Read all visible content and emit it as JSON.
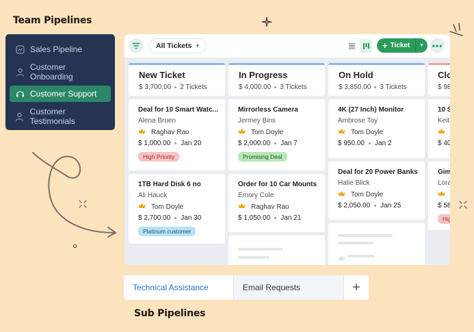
{
  "team_title": "Team Pipelines",
  "sub_title": "Sub Pipelines",
  "sidebar": {
    "items": [
      {
        "label": "Sales Pipeline",
        "icon": "chart-icon",
        "active": false
      },
      {
        "label": "Customer Onboarding",
        "icon": "user-icon",
        "active": false
      },
      {
        "label": "Customer Support",
        "icon": "headset-icon",
        "active": true
      },
      {
        "label": "Customer Testimonials",
        "icon": "user-icon",
        "active": false
      }
    ]
  },
  "toolbar": {
    "filter_label": "All Tickets",
    "ticket_button": "Ticket"
  },
  "columns": [
    {
      "title": "New Ticket",
      "amount": "$ 3,700.00",
      "count": "2 Tickets",
      "cards": [
        {
          "title": "Deal for 10 Smart Watc...",
          "contact": "Alena Bruen",
          "owner": "Raghav Rao",
          "amount": "$ 1,000.00",
          "date": "Jan 20",
          "tag": "High Priority"
        },
        {
          "title": "1TB Hard Disk 6 no",
          "contact": "Ali Hauck",
          "owner": "Tom Doyle",
          "amount": "$ 2,700.00",
          "date": "Jan 30",
          "tag": "Platinum customer"
        }
      ]
    },
    {
      "title": "In Progress",
      "amount": "$ 4,000.00",
      "count": "3 Tickets",
      "cards": [
        {
          "title": "Mirrorless Camera",
          "contact": "Jermey Bins",
          "owner": "Tom Doyle",
          "amount": "$ 2,000.00",
          "date": "Jan 7",
          "tag": "Promising Deal"
        },
        {
          "title": "Order for 10 Car Mounts",
          "contact": "Emory Cole",
          "owner": "Raghav Rao",
          "amount": "$ 1,050.00",
          "date": "Jan 21"
        }
      ]
    },
    {
      "title": "On Hold",
      "amount": "$ 3,850.00",
      "count": "3 Tickets",
      "cards": [
        {
          "title": "4K (27 Inch) Monitor",
          "contact": "Ambrose Toy",
          "owner": "Tom Doyle",
          "amount": "$ 950.00",
          "date": "Jan 2"
        },
        {
          "title": "Deal for 20 Power Banks",
          "contact": "Halie Blick",
          "owner": "Tom Doyle",
          "amount": "$ 2,050.00",
          "date": "Jan 25"
        }
      ]
    },
    {
      "title": "Clo",
      "amount": "$ 98",
      "cards": [
        {
          "title": "10 S",
          "contact": "Keit",
          "amount": "$ 40"
        },
        {
          "title": "Gim",
          "contact": "Lora",
          "amount": "$ 58",
          "tag": "Hig"
        }
      ]
    }
  ],
  "subtabs": [
    {
      "label": "Technical Assistance",
      "active": true
    },
    {
      "label": "Email Requests",
      "active": false
    }
  ],
  "colors": {
    "background": "#fbe3bd",
    "sidebar": "#243452",
    "sidebar_active": "#2c8769",
    "accent_green": "#2a9b5c",
    "tab_active_text": "#1f74c6",
    "tag_high_priority": "#f7c3c3",
    "tag_platinum": "#b7e3f5",
    "tag_promising": "#b8e6b8"
  }
}
